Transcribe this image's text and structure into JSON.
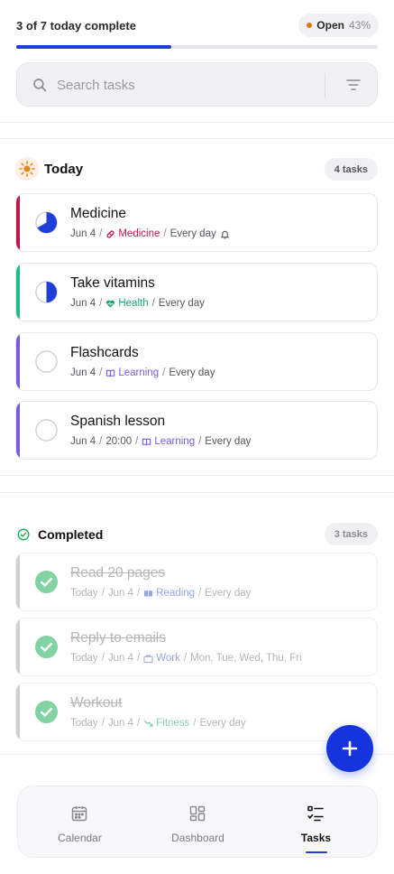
{
  "header": {
    "progress_text": "3 of 7 today complete",
    "progress_fraction": 0.43,
    "open_label": "Open",
    "open_percent": "43%",
    "search_placeholder": "Search tasks"
  },
  "today": {
    "title": "Today",
    "count": "4 tasks",
    "tasks": [
      {
        "title": "Medicine",
        "date": "Jun 4",
        "tag": "Medicine",
        "tag_color": "#c0154a",
        "accent": "#c0154a",
        "repeat": "Every day",
        "status_icon": "pie-three-quarter-icon",
        "tag_icon": "pill-icon",
        "has_bell": true
      },
      {
        "title": "Take vitamins",
        "date": "Jun 4",
        "tag": "Health",
        "tag_color": "#1aa874",
        "accent": "#1fbf7f",
        "repeat": "Every day",
        "status_icon": "pie-half-icon",
        "tag_icon": "heartbeat-icon"
      },
      {
        "title": "Flashcards",
        "date": "Jun 4",
        "tag": "Learning",
        "tag_color": "#7a5be0",
        "accent": "#7a5be0",
        "repeat": "Every day",
        "status_icon": "empty-circle-icon",
        "tag_icon": "book-icon"
      },
      {
        "title": "Spanish lesson",
        "date": "Jun 4",
        "time": "20:00",
        "tag": "Learning",
        "tag_color": "#7a5be0",
        "accent": "#7a5be0",
        "repeat": "Every day",
        "status_icon": "empty-circle-icon",
        "tag_icon": "book-icon"
      }
    ]
  },
  "completed": {
    "title": "Completed",
    "count": "3 tasks",
    "tasks": [
      {
        "title": "Read 20 pages",
        "when": "Today",
        "date": "Jun 4",
        "tag": "Reading",
        "tag_color": "#3a5de0",
        "repeat": "Every day",
        "tag_icon": "open-book-icon"
      },
      {
        "title": "Reply to emails",
        "when": "Today",
        "date": "Jun 4",
        "tag": "Work",
        "tag_color": "#3a5de0",
        "repeat": "Mon, Tue, Wed, Thu, Fri",
        "tag_icon": "briefcase-icon"
      },
      {
        "title": "Workout",
        "when": "Today",
        "date": "Jun 4",
        "tag": "Fitness",
        "tag_color": "#1aa874",
        "repeat": "Every day",
        "tag_icon": "trend-arrow-icon"
      }
    ]
  },
  "colors": {
    "accent": "#1d3fd8",
    "fab": "#1534dc",
    "check_green": "#1fae5b",
    "open_dot": "#d97a0b"
  },
  "nav": {
    "items": [
      {
        "label": "Calendar",
        "icon": "calendar-icon"
      },
      {
        "label": "Dashboard",
        "icon": "dashboard-icon"
      },
      {
        "label": "Tasks",
        "icon": "tasks-icon",
        "active": true
      }
    ]
  }
}
